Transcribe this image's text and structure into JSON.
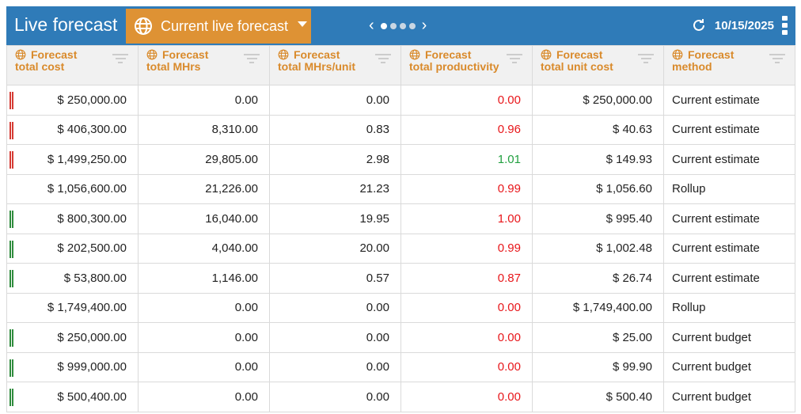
{
  "header": {
    "title": "Live forecast",
    "dropdown_label": "Current live forecast",
    "date": "10/15/2025",
    "pager": {
      "prev": "‹",
      "next": "›",
      "pages": 4,
      "current": 1
    }
  },
  "columns": [
    {
      "line1": "Forecast",
      "line2": "total cost"
    },
    {
      "line1": "Forecast",
      "line2": "total MHrs"
    },
    {
      "line1": "Forecast",
      "line2": "total MHrs/unit"
    },
    {
      "line1": "Forecast",
      "line2": "total productivity"
    },
    {
      "line1": "Forecast",
      "line2": "total unit cost"
    },
    {
      "line1": "Forecast",
      "line2": "method"
    }
  ],
  "colors": {
    "header": "#2f7bb8",
    "accent": "#de9234",
    "red": "#e8161a",
    "green": "#22a040"
  },
  "rows": [
    {
      "status": "red",
      "cost": "$ 250,000.00",
      "mhrs": "0.00",
      "mhrs_unit": "0.00",
      "prod": "0.00",
      "prod_color": "red",
      "unit_cost": "$ 250,000.00",
      "method": "Current estimate"
    },
    {
      "status": "red",
      "cost": "$ 406,300.00",
      "mhrs": "8,310.00",
      "mhrs_unit": "0.83",
      "prod": "0.96",
      "prod_color": "red",
      "unit_cost": "$ 40.63",
      "method": "Current estimate"
    },
    {
      "status": "red",
      "cost": "$ 1,499,250.00",
      "mhrs": "29,805.00",
      "mhrs_unit": "2.98",
      "prod": "1.01",
      "prod_color": "green",
      "unit_cost": "$ 149.93",
      "method": "Current estimate"
    },
    {
      "status": "none",
      "cost": "$ 1,056,600.00",
      "mhrs": "21,226.00",
      "mhrs_unit": "21.23",
      "prod": "0.99",
      "prod_color": "red",
      "unit_cost": "$ 1,056.60",
      "method": "Rollup"
    },
    {
      "status": "green",
      "cost": "$ 800,300.00",
      "mhrs": "16,040.00",
      "mhrs_unit": "19.95",
      "prod": "1.00",
      "prod_color": "red",
      "unit_cost": "$ 995.40",
      "method": "Current estimate"
    },
    {
      "status": "green",
      "cost": "$ 202,500.00",
      "mhrs": "4,040.00",
      "mhrs_unit": "20.00",
      "prod": "0.99",
      "prod_color": "red",
      "unit_cost": "$ 1,002.48",
      "method": "Current estimate"
    },
    {
      "status": "green",
      "cost": "$ 53,800.00",
      "mhrs": "1,146.00",
      "mhrs_unit": "0.57",
      "prod": "0.87",
      "prod_color": "red",
      "unit_cost": "$ 26.74",
      "method": "Current estimate"
    },
    {
      "status": "none",
      "cost": "$ 1,749,400.00",
      "mhrs": "0.00",
      "mhrs_unit": "0.00",
      "prod": "0.00",
      "prod_color": "red",
      "unit_cost": "$ 1,749,400.00",
      "method": "Rollup"
    },
    {
      "status": "green",
      "cost": "$ 250,000.00",
      "mhrs": "0.00",
      "mhrs_unit": "0.00",
      "prod": "0.00",
      "prod_color": "red",
      "unit_cost": "$ 25.00",
      "method": "Current budget"
    },
    {
      "status": "green",
      "cost": "$ 999,000.00",
      "mhrs": "0.00",
      "mhrs_unit": "0.00",
      "prod": "0.00",
      "prod_color": "red",
      "unit_cost": "$ 99.90",
      "method": "Current budget"
    },
    {
      "status": "green",
      "cost": "$ 500,400.00",
      "mhrs": "0.00",
      "mhrs_unit": "0.00",
      "prod": "0.00",
      "prod_color": "red",
      "unit_cost": "$ 500.40",
      "method": "Current budget"
    }
  ]
}
